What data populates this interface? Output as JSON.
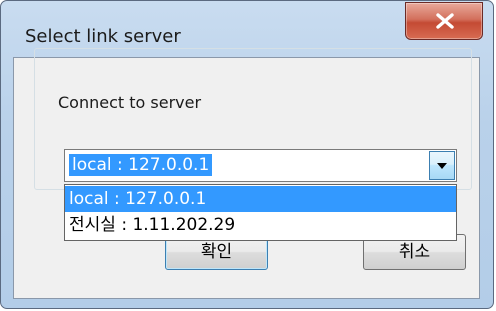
{
  "window": {
    "title": "Select link server"
  },
  "group": {
    "label": "Connect to server"
  },
  "combo": {
    "selected": "local : 127.0.0.1",
    "options": [
      "local : 127.0.0.1",
      "전시실 : 1.11.202.29"
    ]
  },
  "buttons": {
    "ok": "확인",
    "cancel": "취소"
  },
  "colors": {
    "selection": "#3399ff",
    "close_button": "#c44a34"
  },
  "icons": {
    "close": "close-icon",
    "dropdown": "chevron-down-icon"
  }
}
